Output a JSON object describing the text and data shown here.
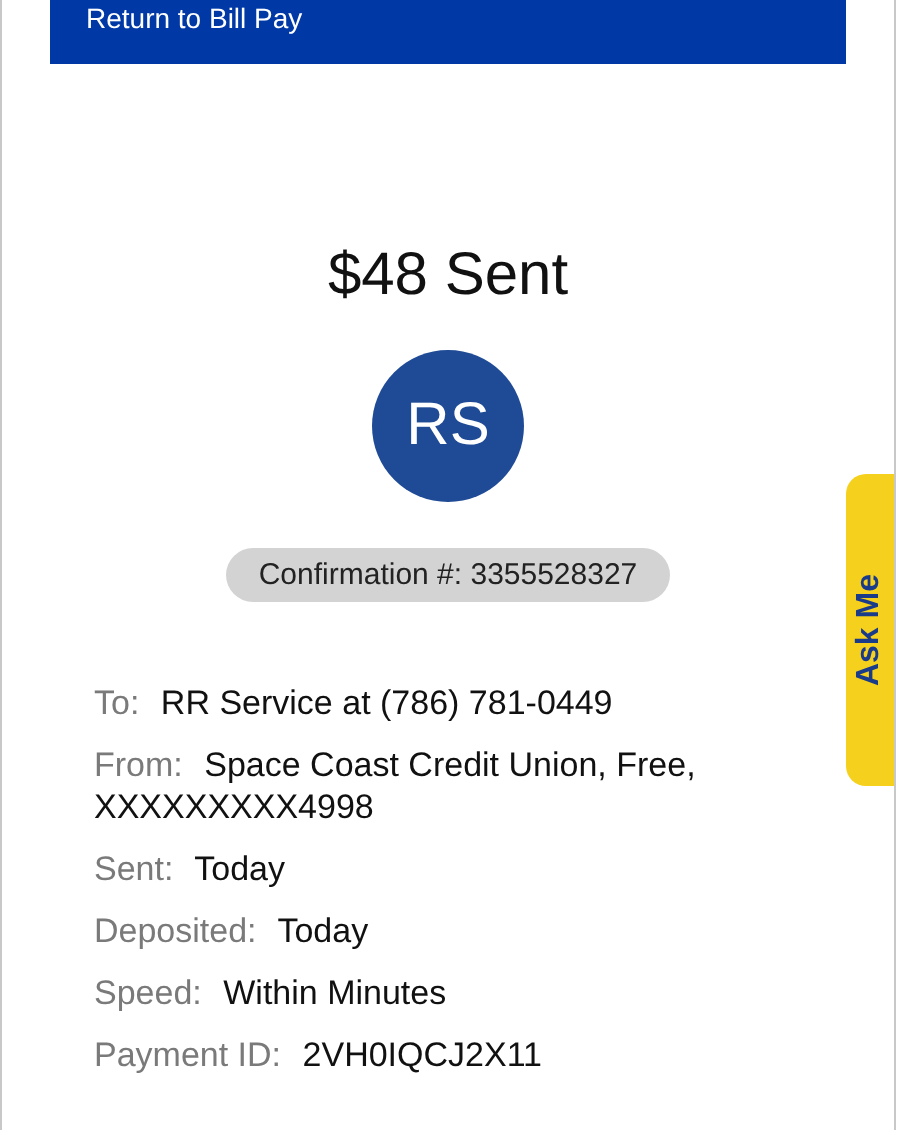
{
  "header": {
    "back_link": "Return to Bill Pay"
  },
  "amount_title": "$48 Sent",
  "avatar": {
    "initials": "RS"
  },
  "confirmation": "Confirmation #: 3355528327",
  "details": [
    {
      "label": "To:",
      "value": "RR Service at (786) 781-0449"
    },
    {
      "label": "From:",
      "value": "Space Coast Credit Union, Free, XXXXXXXXX4998"
    },
    {
      "label": "Sent:",
      "value": "Today"
    },
    {
      "label": "Deposited:",
      "value": "Today"
    },
    {
      "label": "Speed:",
      "value": "Within Minutes"
    },
    {
      "label": "Payment ID:",
      "value": "2VH0IQCJ2X11"
    }
  ],
  "ask_me_tab": "Ask Me"
}
